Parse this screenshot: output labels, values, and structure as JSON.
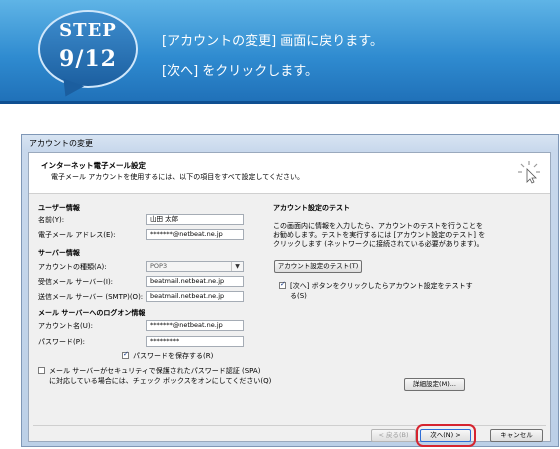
{
  "banner": {
    "step_word": "STEP",
    "step_num": "9/12",
    "line1": "[アカウントの変更] 画面に戻ります。",
    "line2": "[次へ] をクリックします。"
  },
  "dialog": {
    "title": "アカウントの変更",
    "header_title": "インターネット電子メール設定",
    "header_sub": "電子メール アカウントを使用するには、以下の項目をすべて設定してください。",
    "user_section": "ユーザー情報",
    "name_label": "名前(Y):",
    "name_value": "山田 太郎",
    "email_label": "電子メール アドレス(E):",
    "email_value": "*******@netbeat.ne.jp",
    "server_section": "サーバー情報",
    "account_type_label": "アカウントの種類(A):",
    "account_type_value": "POP3",
    "incoming_label": "受信メール サーバー(I):",
    "incoming_value": "beatmail.netbeat.ne.jp",
    "outgoing_label": "送信メール サーバー (SMTP)(O):",
    "outgoing_value": "beatmail.netbeat.ne.jp",
    "logon_section": "メール サーバーへのログオン情報",
    "account_name_label": "アカウント名(U):",
    "account_name_value": "*******@netbeat.ne.jp",
    "password_label": "パスワード(P):",
    "password_value": "*********",
    "save_password_label": "パスワードを保存する(R)",
    "spa_line1": "メール サーバーがセキュリティで保護されたパスワード認証 (SPA)",
    "spa_line2": "に対応している場合には、チェック ボックスをオンにしてください(Q)",
    "test_section": "アカウント設定のテスト",
    "test_desc1": "この画面内に情報を入力したら、アカウントのテストを行うことを",
    "test_desc2": "お勧めします。テストを実行するには [アカウント設定のテスト] を",
    "test_desc3": "クリックします (ネットワークに接続されている必要があります)。",
    "test_button": "アカウント設定のテスト(T)",
    "test_next_line1": "[次へ] ボタンをクリックしたらアカウント設定をテストす",
    "test_next_line2": "る(S)",
    "more_settings": "詳細設定(M)...",
    "back_button": "< 戻る(B)",
    "next_button": "次へ(N) >",
    "cancel_button": "キャンセル"
  },
  "colors": {
    "banner_top": "#5fb4e6",
    "banner_bottom": "#1f6fb7",
    "highlight": "#d6242f"
  },
  "icons": [
    "cursor-icon",
    "dropdown-arrow-icon",
    "checkbox-checked-icon"
  ]
}
